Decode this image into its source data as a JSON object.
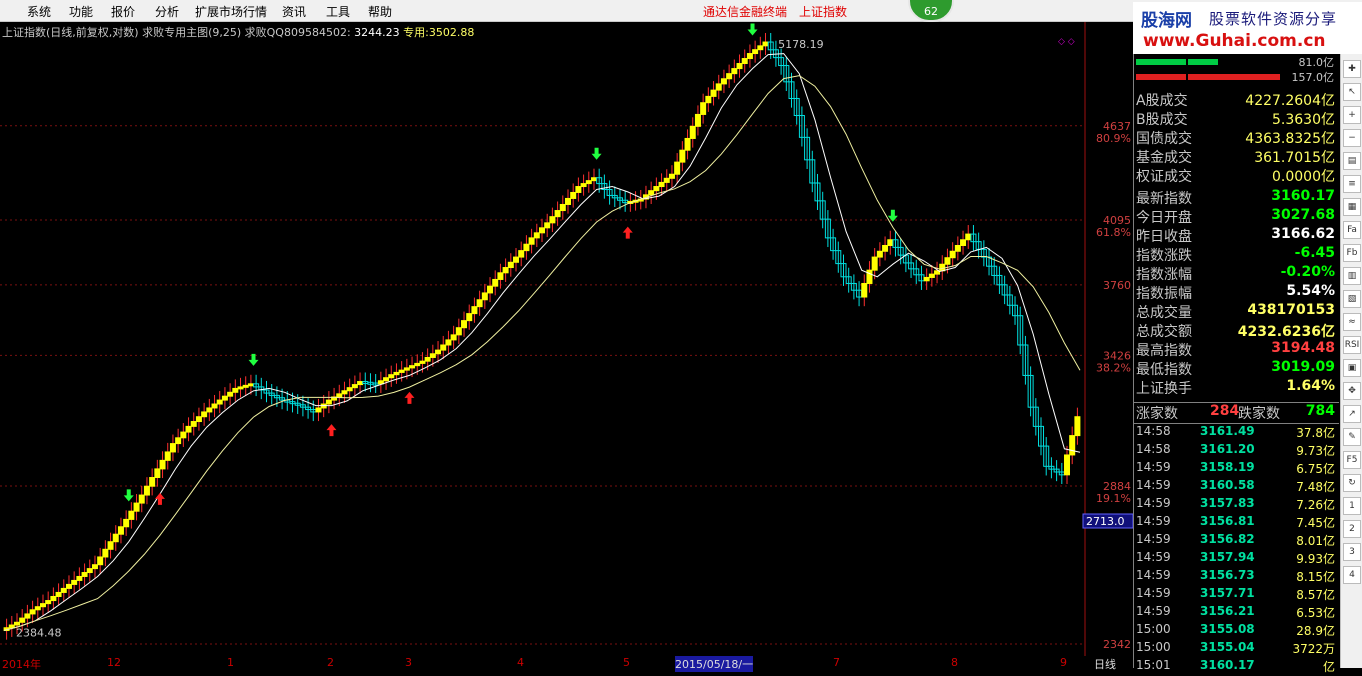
{
  "menu": {
    "items": [
      "系统",
      "功能",
      "报价",
      "分析",
      "扩展市场行情",
      "资讯",
      "工具",
      "帮助"
    ],
    "title_left": "通达信金融终端",
    "title_right": "上证指数",
    "badge": "62"
  },
  "watermark": {
    "line1": "股海网",
    "line2": "股票软件资源分享",
    "line3": "www.Guhai.com.cn"
  },
  "chart_header": {
    "title": "上证指数(日线,前复权,对数) 求败专用主图(9,25) 求败QQ809584502:",
    "val1": "3244.23",
    "label2": "专用:",
    "val2": "3502.88"
  },
  "price_axis": [
    {
      "price": "4637",
      "pct": "80.9%"
    },
    {
      "price": "4095",
      "pct": "61.8%"
    },
    {
      "price": "3760",
      "pct": ""
    },
    {
      "price": "3426",
      "pct": "38.2%"
    },
    {
      "price": "2884",
      "pct": "19.1%"
    },
    {
      "price": "2342",
      "pct": ""
    }
  ],
  "cursor_price": "2713.0",
  "peak_label": "5178.19",
  "low_label": "2384.48",
  "date_axis": [
    "2014年",
    "12",
    "1",
    "2",
    "3",
    "4",
    "5",
    "2015/05/18/一",
    "7",
    "8",
    "9"
  ],
  "period_label": "日线",
  "top_bars": {
    "v1": "81.0亿",
    "v2": "157.0亿"
  },
  "turnover": [
    {
      "k": "A股成交",
      "v": "4227.2604亿"
    },
    {
      "k": "B股成交",
      "v": "5.3630亿"
    },
    {
      "k": "国债成交",
      "v": "4363.8325亿"
    },
    {
      "k": "基金成交",
      "v": "361.7015亿"
    },
    {
      "k": "权证成交",
      "v": "0.0000亿"
    }
  ],
  "stats": [
    {
      "k": "最新指数",
      "v": "3160.17",
      "c": "#00ff00"
    },
    {
      "k": "今日开盘",
      "v": "3027.68",
      "c": "#00ff00"
    },
    {
      "k": "昨日收盘",
      "v": "3166.62",
      "c": "#ffffff"
    },
    {
      "k": "指数涨跌",
      "v": "-6.45",
      "c": "#00ff00"
    },
    {
      "k": "指数涨幅",
      "v": "-0.20%",
      "c": "#00ff00"
    },
    {
      "k": "指数振幅",
      "v": "5.54%",
      "c": "#ffffff"
    },
    {
      "k": "总成交量",
      "v": "438170153",
      "c": "#ffff66"
    },
    {
      "k": "总成交额",
      "v": "4232.6236亿",
      "c": "#ffff66"
    },
    {
      "k": "最高指数",
      "v": "3194.48",
      "c": "#ff4040"
    },
    {
      "k": "最低指数",
      "v": "3019.09",
      "c": "#00ff00"
    },
    {
      "k": "上证换手",
      "v": "1.64%",
      "c": "#ffff66"
    }
  ],
  "updown": {
    "up_label": "涨家数",
    "up": "284",
    "down_label": "跌家数",
    "down": "784"
  },
  "ticks": [
    {
      "t": "14:58",
      "p": "3161.49",
      "q": "37.8亿"
    },
    {
      "t": "14:58",
      "p": "3161.20",
      "q": "9.73亿"
    },
    {
      "t": "14:59",
      "p": "3158.19",
      "q": "6.75亿"
    },
    {
      "t": "14:59",
      "p": "3160.58",
      "q": "7.48亿"
    },
    {
      "t": "14:59",
      "p": "3157.83",
      "q": "7.26亿"
    },
    {
      "t": "14:59",
      "p": "3156.81",
      "q": "7.45亿"
    },
    {
      "t": "14:59",
      "p": "3156.82",
      "q": "8.01亿"
    },
    {
      "t": "14:59",
      "p": "3157.94",
      "q": "9.93亿"
    },
    {
      "t": "14:59",
      "p": "3156.73",
      "q": "8.15亿"
    },
    {
      "t": "14:59",
      "p": "3157.71",
      "q": "8.57亿"
    },
    {
      "t": "14:59",
      "p": "3156.21",
      "q": "6.53亿"
    },
    {
      "t": "15:00",
      "p": "3155.08",
      "q": "28.9亿"
    },
    {
      "t": "15:00",
      "p": "3155.04",
      "q": "3722万"
    },
    {
      "t": "15:01",
      "p": "3160.17",
      "q": "亿"
    }
  ],
  "toolbar_icons": [
    "cross-icon",
    "cursor-icon",
    "zoom-in-icon",
    "zoom-out-icon",
    "tile-icon",
    "list-icon",
    "grid-icon",
    "fa-icon",
    "fb-icon",
    "chart-icon",
    "bars-icon",
    "wave-icon",
    "rsi-icon",
    "box-icon",
    "move-icon",
    "arrow-icon",
    "pen-icon",
    "f5-icon",
    "refresh-icon",
    "1-icon",
    "2-icon",
    "3-icon",
    "4-icon"
  ],
  "toolbar_glyphs": [
    "✚",
    "↖",
    "+",
    "−",
    "▤",
    "≡",
    "▦",
    "Fa",
    "Fb",
    "▥",
    "▧",
    "≈",
    "RSI",
    "▣",
    "✥",
    "↗",
    "✎",
    "F5",
    "↻",
    "1",
    "2",
    "3",
    "4"
  ],
  "chart_data": {
    "type": "candlestick",
    "title": "上证指数(日线,前复权,对数)",
    "colors": {
      "up_body": "#ffff00",
      "down_body": "#00ffff",
      "signal_up": "#ff00ff",
      "ma": "#ffffff"
    },
    "y_log": true,
    "ylim": [
      2342,
      5178.19
    ],
    "series": [
      {
        "name": "close",
        "values": [
          2384,
          2410,
          2450,
          2480,
          2520,
          2560,
          2600,
          2680,
          2760,
          2850,
          2950,
          3050,
          3120,
          3180,
          3230,
          3280,
          3300,
          3260,
          3230,
          3210,
          3180,
          3230,
          3270,
          3310,
          3300,
          3340,
          3370,
          3400,
          3450,
          3520,
          3620,
          3720,
          3820,
          3900,
          4000,
          4080,
          4180,
          4280,
          4330,
          4230,
          4190,
          4210,
          4280,
          4350,
          4560,
          4780,
          4900,
          5000,
          5100,
          5178,
          5020,
          4700,
          4300,
          4000,
          3800,
          3700,
          3900,
          3990,
          3870,
          3780,
          3830,
          3930,
          4020,
          3900,
          3760,
          3610,
          3200,
          2960,
          2927,
          3160
        ]
      }
    ]
  }
}
